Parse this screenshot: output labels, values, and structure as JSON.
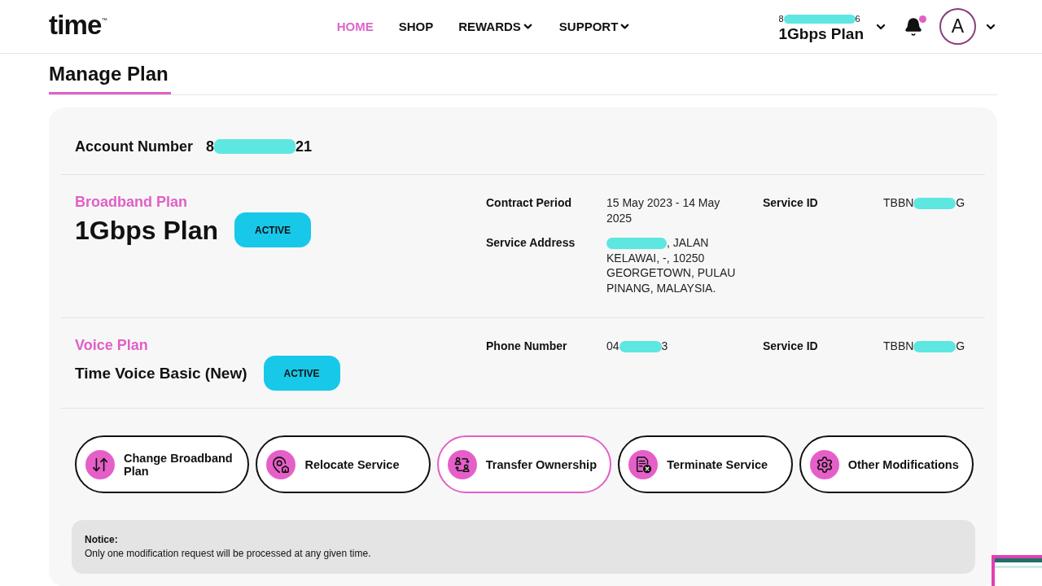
{
  "header": {
    "logo": "time",
    "logo_mark": "™",
    "nav": [
      {
        "label": "HOME",
        "selected": true,
        "has_menu": false
      },
      {
        "label": "SHOP",
        "selected": false,
        "has_menu": false
      },
      {
        "label": "REWARDS",
        "selected": false,
        "has_menu": true
      },
      {
        "label": "SUPPORT",
        "selected": false,
        "has_menu": true
      }
    ],
    "account_switcher": {
      "number_start": "8",
      "redacted": true,
      "number_end": "6",
      "plan": "1Gbps Plan"
    },
    "notifications": {
      "unread": true
    },
    "avatar": {
      "initial": "A"
    }
  },
  "page_title": "Manage Plan",
  "account": {
    "label": "Account Number",
    "value_start": "8",
    "redacted": true,
    "value_end": "21"
  },
  "plans": [
    {
      "kind": "broadband",
      "title": "Broadband Plan",
      "name": "1Gbps Plan",
      "status": "ACTIVE",
      "details": [
        {
          "label": "Contract Period",
          "value": "15 May 2023 - 14 May 2025"
        },
        {
          "label": "Service ID",
          "value_start": "TBBN",
          "redacted": true,
          "value_end": "G"
        },
        {
          "label": "Service Address",
          "redacted": true,
          "value_end": ", JALAN KELAWAI, -, 10250 GEORGETOWN, PULAU PINANG, MALAYSIA."
        }
      ]
    },
    {
      "kind": "voice",
      "title": "Voice Plan",
      "name": "Time Voice Basic (New)",
      "status": "ACTIVE",
      "details": [
        {
          "label": "Phone Number",
          "value_start": "04",
          "redacted": true,
          "value_end": "3"
        },
        {
          "label": "Service ID",
          "value_start": "TBBN",
          "redacted": true,
          "value_end": "G"
        }
      ]
    }
  ],
  "actions": [
    {
      "label": "Change Broadband Plan",
      "selected": false
    },
    {
      "label": "Relocate Service",
      "selected": false
    },
    {
      "label": "Transfer Ownership",
      "selected": true
    },
    {
      "label": "Terminate Service",
      "selected": false
    },
    {
      "label": "Other Modifications",
      "selected": false
    }
  ],
  "notice": {
    "title": "Notice:",
    "text": "Only one modification request will be processed at any given time."
  }
}
